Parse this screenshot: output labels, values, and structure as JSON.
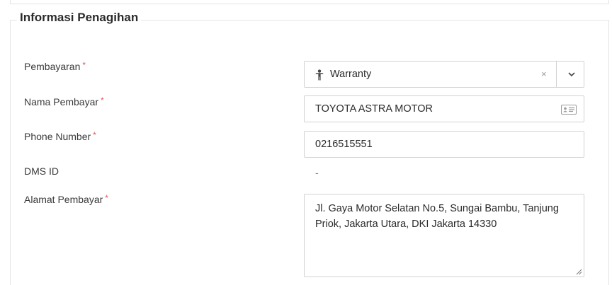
{
  "section": {
    "title": "Informasi Penagihan"
  },
  "required_mark": "*",
  "fields": {
    "pembayaran": {
      "label": "Pembayaran",
      "value": "Warranty",
      "clear_glyph": "×",
      "icon": "person-icon"
    },
    "nama_pembayar": {
      "label": "Nama Pembayar",
      "value": "TOYOTA ASTRA MOTOR",
      "icon": "id-card-icon"
    },
    "phone_number": {
      "label": "Phone Number",
      "value": "0216515551"
    },
    "dms_id": {
      "label": "DMS ID",
      "value": "-"
    },
    "alamat_pembayar": {
      "label": "Alamat Pembayar",
      "value": "Jl. Gaya Motor Selatan No.5, Sungai Bambu, Tanjung Priok, Jakarta Utara, DKI Jakarta 14330"
    }
  },
  "colors": {
    "required": "#e05b5b",
    "border": "#d2d2d2",
    "section_border": "#e4e4e4"
  }
}
